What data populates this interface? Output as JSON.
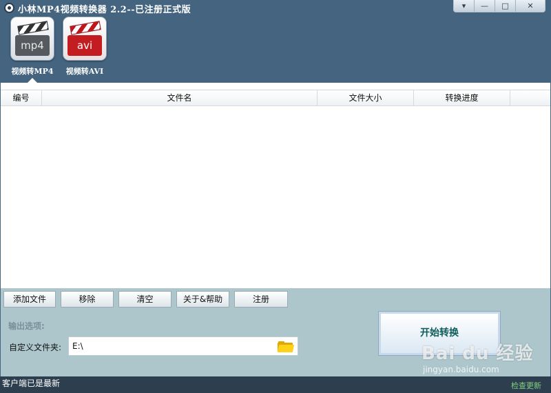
{
  "window": {
    "title": "小林MP4视频转换器 2.2--已注册正式版",
    "controls": {
      "menu": "▾",
      "minimize": "—",
      "maximize": "□",
      "close": "✕"
    }
  },
  "toolbar": {
    "items": [
      {
        "label": "视频转MP4",
        "badge": "mp4",
        "icon": "mp4-clapper-icon",
        "selected": true
      },
      {
        "label": "视频转AVI",
        "badge": "avi",
        "icon": "avi-clapper-icon",
        "selected": false
      }
    ]
  },
  "file_list": {
    "columns": [
      "编号",
      "文件名",
      "文件大小",
      "转换进度"
    ],
    "rows": []
  },
  "actions": {
    "add_file": "添加文件",
    "remove": "移除",
    "clear": "清空",
    "about_help": "关于&帮助",
    "register": "注册"
  },
  "output": {
    "heading": "输出选项:",
    "folder_label": "自定义文件夹:",
    "folder_value": "E:\\",
    "browse_icon": "folder-icon"
  },
  "start_button": "开始转换",
  "status": {
    "text": "客户端已是最新",
    "update_link": "检查更新"
  },
  "watermark": {
    "logo": "Bai du 经验",
    "url": "jingyan.baidu.com"
  },
  "colors": {
    "header_bg": "#44647f",
    "panel_bg": "#adc6cc",
    "status_bg": "#2d3f4f",
    "start_text": "#0f5b5c",
    "update_link": "#7fd07f"
  }
}
